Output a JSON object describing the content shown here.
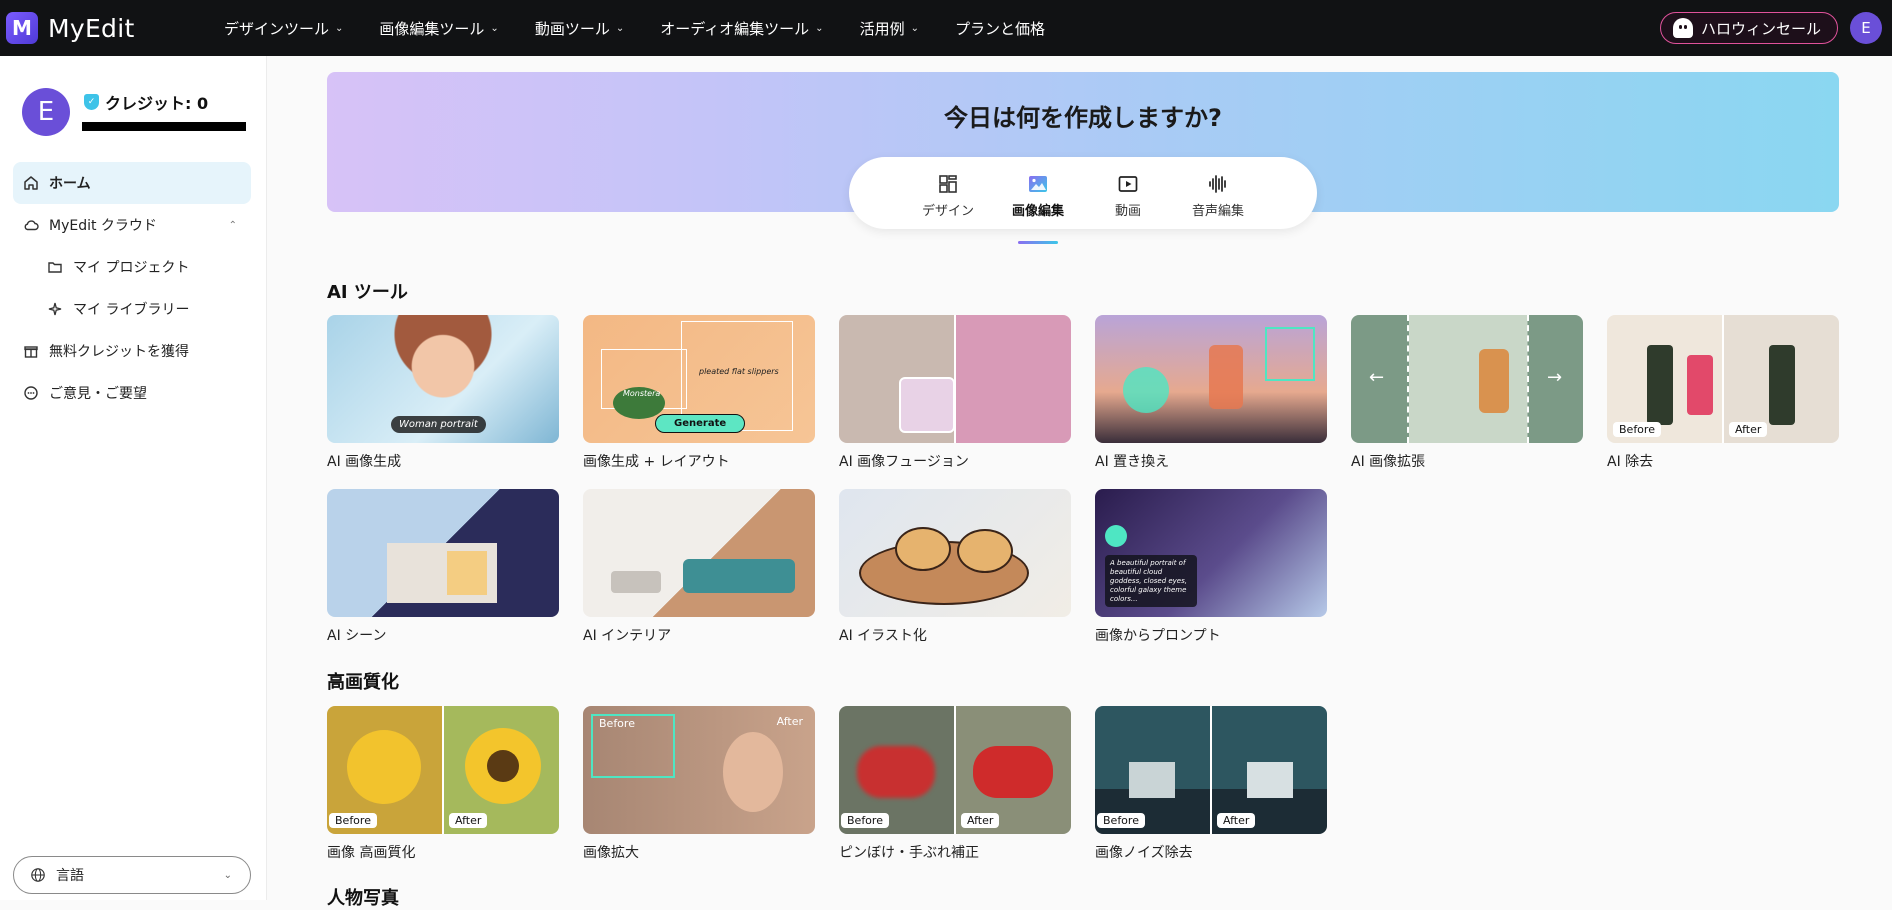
{
  "app": {
    "logo_letter": "M",
    "name": "MyEdit"
  },
  "topnav": {
    "items": [
      {
        "label": "デザインツール"
      },
      {
        "label": "画像編集ツール"
      },
      {
        "label": "動画ツール"
      },
      {
        "label": "オーディオ編集ツール"
      },
      {
        "label": "活用例"
      },
      {
        "label": "プランと価格"
      }
    ],
    "promo_label": "ハロウィンセール",
    "avatar_letter": "E"
  },
  "sidebar": {
    "avatar_letter": "E",
    "credits": "クレジット: 0",
    "items": [
      {
        "label": "ホーム"
      },
      {
        "label": "MyEdit クラウド"
      },
      {
        "label": "マイ プロジェクト"
      },
      {
        "label": "マイ ライブラリー"
      },
      {
        "label": "無料クレジットを獲得"
      },
      {
        "label": "ご意見・ご要望"
      }
    ],
    "language_label": "言語"
  },
  "hero": {
    "title": "今日は何を作成しますか?",
    "tabs": [
      {
        "label": "デザイン"
      },
      {
        "label": "画像編集"
      },
      {
        "label": "動画"
      },
      {
        "label": "音声編集"
      }
    ],
    "active_tab": "画像編集"
  },
  "sections": {
    "ai_tools": {
      "title": "AI ツール",
      "cards": [
        {
          "label": "AI 画像生成",
          "overlay": "Woman portrait"
        },
        {
          "label": "画像生成 + レイアウト",
          "overlay_1": "Generate",
          "overlay_2": "pleated flat slippers",
          "overlay_3": "Monstera"
        },
        {
          "label": "AI 画像フュージョン"
        },
        {
          "label": "AI 置き換え"
        },
        {
          "label": "AI 画像拡張"
        },
        {
          "label": "AI 除去",
          "before": "Before",
          "after": "After"
        },
        {
          "label": "AI シーン"
        },
        {
          "label": "AI インテリア"
        },
        {
          "label": "AI イラスト化"
        },
        {
          "label": "画像からプロンプト",
          "overlay": "A beautiful portrait of beautiful cloud goddess, closed eyes, colorful galaxy theme colors..."
        }
      ]
    },
    "enhance": {
      "title": "高画質化",
      "cards": [
        {
          "label": "画像 高画質化",
          "before": "Before",
          "after": "After"
        },
        {
          "label": "画像拡大",
          "before": "Before",
          "after": "After"
        },
        {
          "label": "ピンぼけ・手ぶれ補正",
          "before": "Before",
          "after": "After"
        },
        {
          "label": "画像ノイズ除去",
          "before": "Before",
          "after": "After"
        }
      ]
    },
    "portrait": {
      "title": "人物写真"
    }
  }
}
